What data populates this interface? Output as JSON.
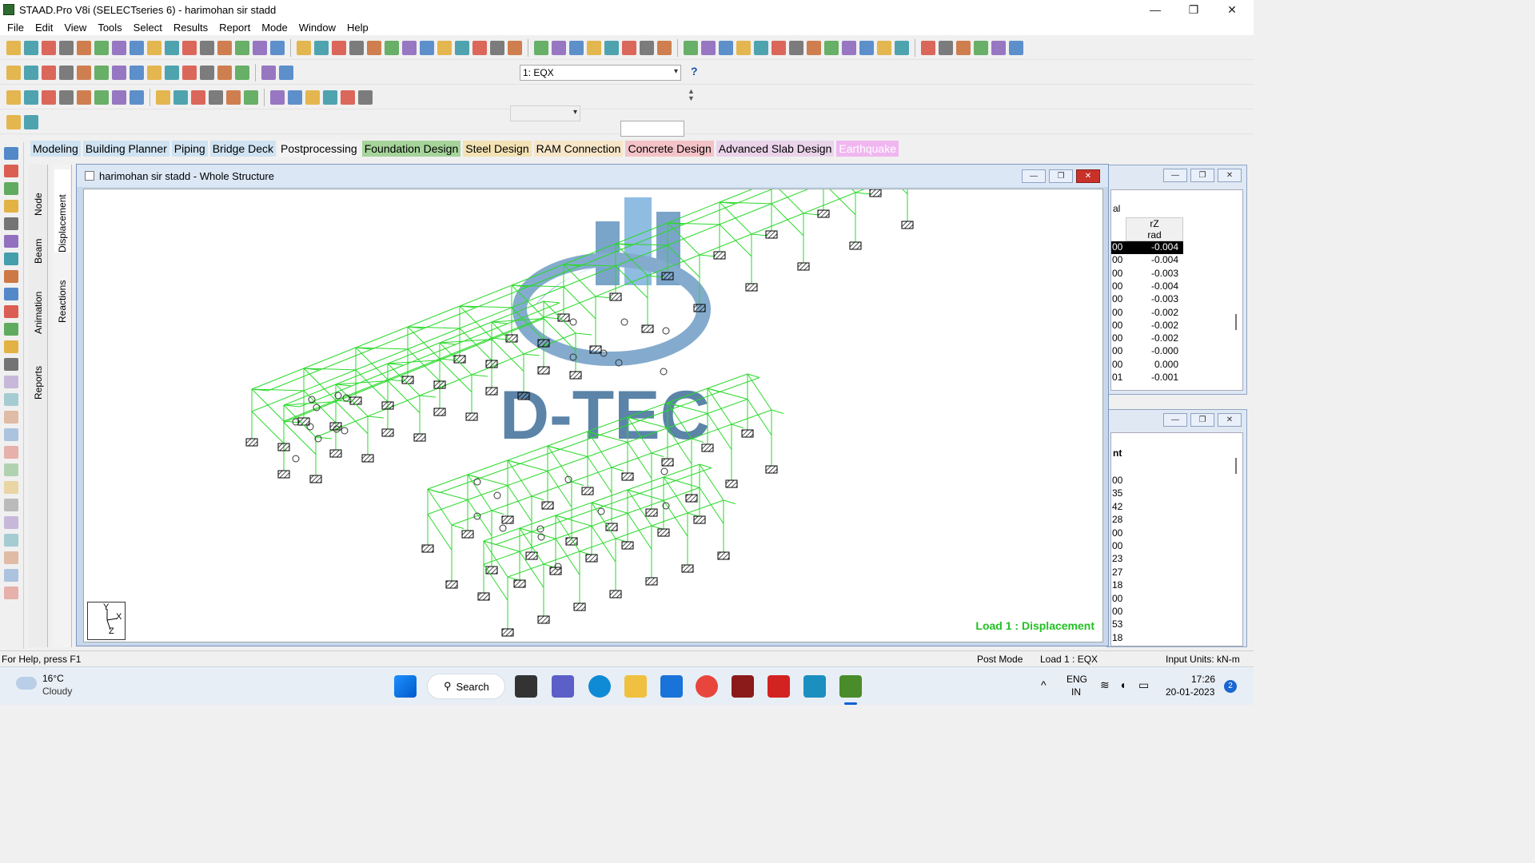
{
  "window": {
    "title": "STAAD.Pro V8i (SELECTseries 6) - harimohan sir stadd",
    "minimize": "—",
    "restore": "❐",
    "close": "✕"
  },
  "menu": [
    "File",
    "Edit",
    "View",
    "Tools",
    "Select",
    "Results",
    "Report",
    "Mode",
    "Window",
    "Help"
  ],
  "toolbar": {
    "load_case": "1: EQX",
    "load_case_selected": "1: EQX"
  },
  "mode_tabs": [
    {
      "label": "Modeling",
      "bg": "#cfe3f2"
    },
    {
      "label": "Building Planner",
      "bg": "#cfe3f2"
    },
    {
      "label": "Piping",
      "bg": "#cfe3f2"
    },
    {
      "label": "Bridge Deck",
      "bg": "#cfe3f2"
    },
    {
      "label": "Postprocessing",
      "bg": "#f3f3f3"
    },
    {
      "label": "Foundation Design",
      "bg": "#a6d49a"
    },
    {
      "label": "Steel Design",
      "bg": "#f3e2b4"
    },
    {
      "label": "RAM Connection",
      "bg": "#f7e6c8"
    },
    {
      "label": "Concrete Design",
      "bg": "#f4c3c8"
    },
    {
      "label": "Advanced Slab Design",
      "bg": "#ead4ea"
    },
    {
      "label": "Earthquake",
      "bg": "#f0b6f0"
    }
  ],
  "page_tabs": {
    "node": "Node",
    "beam": "Beam",
    "animation": "Animation",
    "reports": "Reports",
    "displacement": "Displacement",
    "reactions": "Reactions"
  },
  "view_window": {
    "title": "harimohan sir stadd - Whole Structure",
    "load_label": "Load 1 : Displacement",
    "axis_y": "Y",
    "axis_x": "X",
    "axis_z": "Z",
    "watermark": "D-TEC"
  },
  "table_window": {
    "header_partial": "al",
    "col_header": "rZ",
    "col_unit": "rad",
    "left_partial": [
      "00",
      "00",
      "00",
      "00",
      "00",
      "00",
      "00",
      "00",
      "00",
      "00",
      "01"
    ],
    "values": [
      "-0.004",
      "-0.004",
      "-0.003",
      "-0.004",
      "-0.003",
      "-0.002",
      "-0.002",
      "-0.002",
      "-0.000",
      "0.000",
      "-0.001"
    ]
  },
  "table_window2": {
    "header_partial": "nt",
    "left_partial": [
      "00",
      "35",
      "42",
      "28",
      "00",
      "00",
      "23",
      "27",
      "18",
      "00",
      "00",
      "53",
      "18"
    ]
  },
  "status": {
    "help": "For Help, press F1",
    "mode": "Post Mode",
    "load": "Load 1 : EQX",
    "units": "Input Units:  kN-m"
  },
  "taskbar": {
    "temperature": "16°C",
    "weather": "Cloudy",
    "search": "Search",
    "lang1": "ENG",
    "lang2": "IN",
    "time": "17:26",
    "date": "20-01-2023",
    "notif": "2"
  },
  "colors": {
    "frame": "#2bd92b",
    "load_label": "#22c022",
    "highlight": "#000000"
  }
}
